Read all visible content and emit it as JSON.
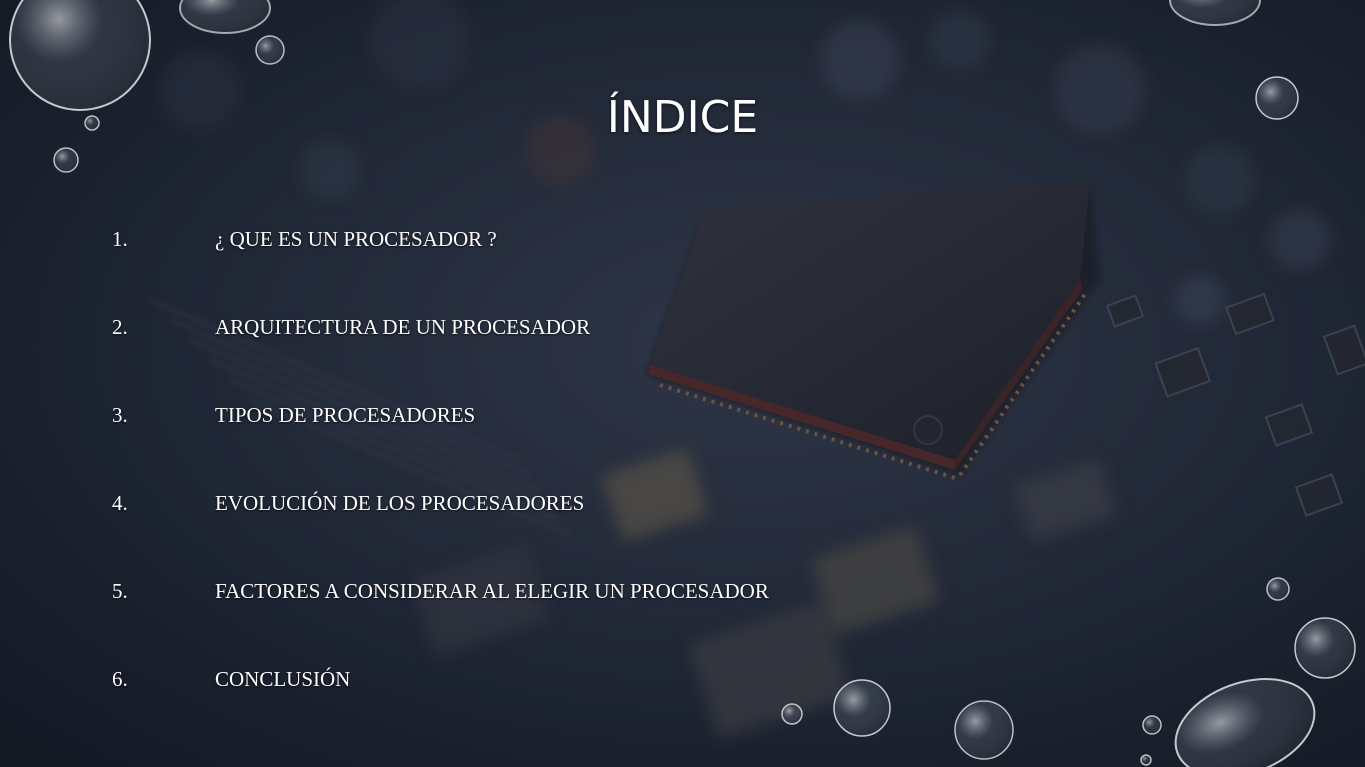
{
  "slide": {
    "title": "ÍNDICE",
    "items": [
      {
        "number": "1.",
        "label": "¿ QUE ES UN PROCESADOR ?"
      },
      {
        "number": "2.",
        "label": "ARQUITECTURA DE UN PROCESADOR"
      },
      {
        "number": "3.",
        "label": "TIPOS DE PROCESADORES"
      },
      {
        "number": "4.",
        "label": "EVOLUCIÓN DE LOS PROCESADORES"
      },
      {
        "number": "5.",
        "label": "FACTORES A CONSIDERAR AL ELEGIR UN PROCESADOR"
      },
      {
        "number": "6.",
        "label": "CONCLUSIÓN"
      }
    ]
  },
  "colors": {
    "text": "#ffffff",
    "background": "#1b2231",
    "chip": "#2a2c35",
    "pins": "#8a6a4a"
  },
  "decorations": {
    "background_image": "circuit-board-with-processor-chip",
    "overlay": "water-droplets"
  }
}
